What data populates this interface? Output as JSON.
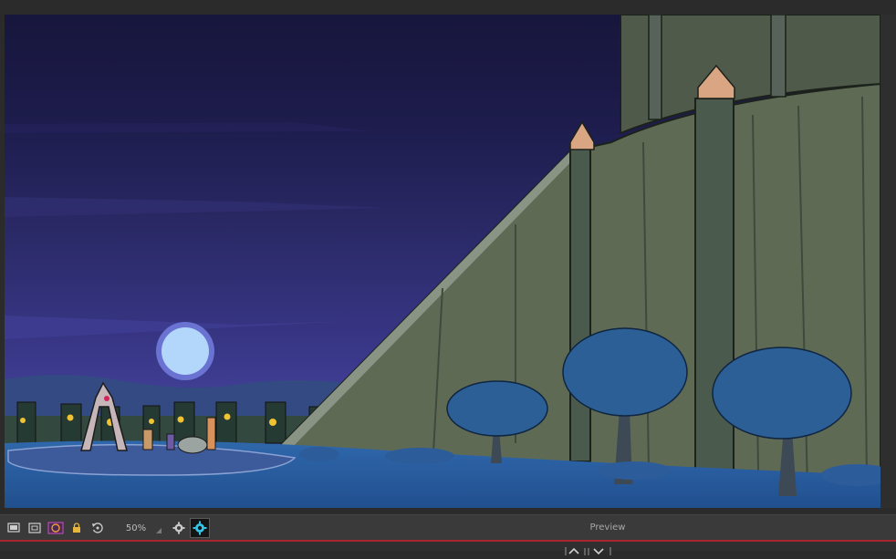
{
  "toolbar": {
    "zoom": "50%",
    "preview_label": "Preview"
  },
  "colors": {
    "sky_top": "#19183f",
    "sky_mid": "#2c2a6a",
    "sky_low": "#4a47a0",
    "moon": "#b3d6fb",
    "cliff": "#5f6a55",
    "ground": "#2a5c9e",
    "tree_foliage": "#2c5f96",
    "accent_bar": "#a8262c"
  },
  "icons": {
    "display": "monitor-icon",
    "safe_area": "safe-area-icon",
    "onion_skin": "onion-skin-icon",
    "lock": "lock-icon",
    "reset_view": "reset-view-icon",
    "render": "render-gear-icon",
    "preview_toggle": "preview-toggle-icon",
    "collapse": "collapse-chevrons-icon"
  }
}
